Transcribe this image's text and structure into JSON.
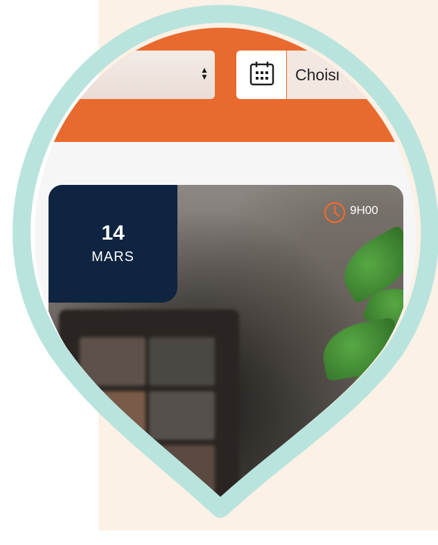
{
  "filters": {
    "select_value": "",
    "date_placeholder": "Choisi"
  },
  "event": {
    "day": "14",
    "month": "MARS",
    "time": "9H00"
  },
  "icons": {
    "calendar": "calendar-icon",
    "clock": "clock-icon",
    "select_arrows": "sort-arrows-icon"
  },
  "colors": {
    "accent_orange": "#e86a2e",
    "badge_navy": "#0e2440",
    "pin_teal": "#b9e4dd",
    "cream": "#fcf1e6"
  }
}
